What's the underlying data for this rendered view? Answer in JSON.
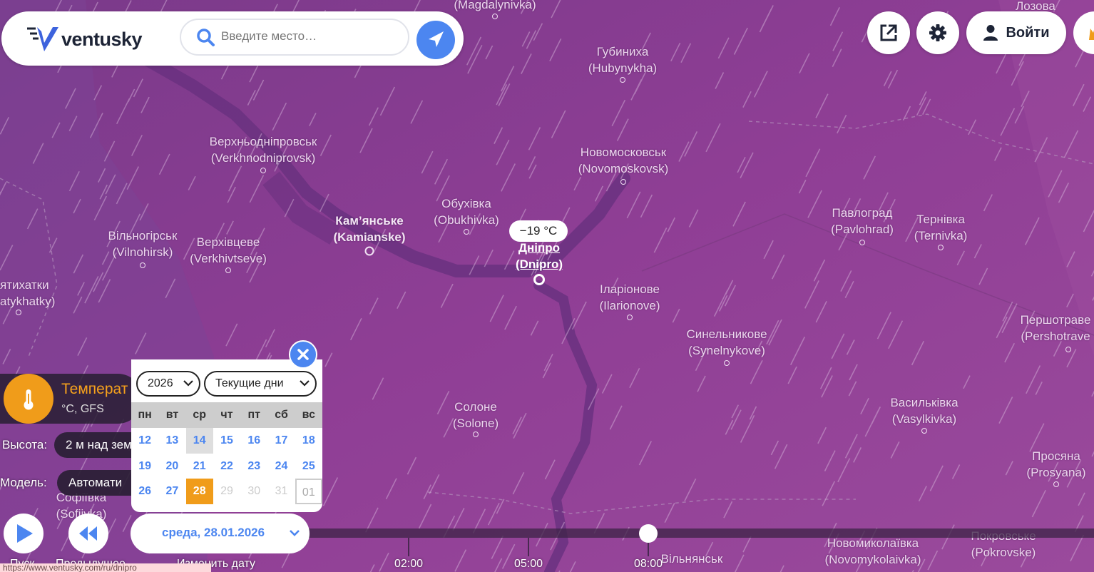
{
  "app": {
    "brand": "ventusky",
    "search_placeholder": "Введите место…",
    "login_label": "Войти"
  },
  "colors": {
    "accent": "#4c86f0",
    "layer_orange": "#f09c1a",
    "map_purple": "#8c3f92"
  },
  "map": {
    "selected_city": {
      "name": "Дніпро",
      "latin": "(Dnipro)",
      "temperature": "−19 °C"
    },
    "cities": [
      {
        "name": "(Magdalynivka)",
        "latin": ""
      },
      {
        "name": "Лозова",
        "latin": ""
      },
      {
        "name": "Губиниха",
        "latin": "(Hubynykha)"
      },
      {
        "name": "Верхньодніпровськ",
        "latin": "(Verkhnodniprovsk)"
      },
      {
        "name": "Новомосковськ",
        "latin": "(Novomoskovsk)"
      },
      {
        "name": "Обухівка",
        "latin": "(Obukhivka)"
      },
      {
        "name": "Кам’янське",
        "latin": "(Kamianske)"
      },
      {
        "name": "Вільногірськ",
        "latin": "(Vilnohirsk)"
      },
      {
        "name": "Верхівцеве",
        "latin": "(Verkhivtseve)"
      },
      {
        "name": "ятихатки",
        "latin": "atykhatky)"
      },
      {
        "name": "Павлоград",
        "latin": "(Pavlohrad)"
      },
      {
        "name": "Тернівка",
        "latin": "(Ternivka)"
      },
      {
        "name": "Іларіонове",
        "latin": "(Ilarionove)"
      },
      {
        "name": "Першотраве",
        "latin": "(Pershotrave"
      },
      {
        "name": "Синельникове",
        "latin": "(Synelnykove)"
      },
      {
        "name": "Солоне",
        "latin": "(Solone)"
      },
      {
        "name": "Васильківка",
        "latin": "(Vasylkivka)"
      },
      {
        "name": "Просяна",
        "latin": "(Prosyana)"
      },
      {
        "name": "Софіївка",
        "latin": "(Sofiivka)"
      },
      {
        "name": "Новомиколаївка",
        "latin": "(Novomykolaivka)"
      },
      {
        "name": "Покровське",
        "latin": "(Pokrovske)"
      },
      {
        "name": "Вільнянськ",
        "latin": ""
      }
    ]
  },
  "layer": {
    "title": "Температ",
    "subtitle": "°C, GFS",
    "height_label": "Высота:",
    "height_value": "2 м над зем",
    "model_label": "Модель:",
    "model_value": "Автомати"
  },
  "calendar": {
    "year": "2026",
    "range": "Текущие дни",
    "weekdays": [
      "пн",
      "вт",
      "ср",
      "чт",
      "пт",
      "сб",
      "вс"
    ],
    "weeks": [
      [
        "12",
        "13",
        "14",
        "15",
        "16",
        "17",
        "18"
      ],
      [
        "19",
        "20",
        "21",
        "22",
        "23",
        "24",
        "25"
      ],
      [
        "26",
        "27",
        "28",
        "29",
        "30",
        "31",
        "01"
      ]
    ]
  },
  "timeline": {
    "date_label": "среда, 28.01.2026",
    "ticks": [
      "02:00",
      "05:00",
      "08:00"
    ],
    "play_label": "Пуск",
    "prev_label": "Предыдущее",
    "change_date_label": "Изменить дату",
    "position": 0.43
  },
  "status_bar": {
    "url": "https://www.ventusky.com/ru/dnipro"
  }
}
